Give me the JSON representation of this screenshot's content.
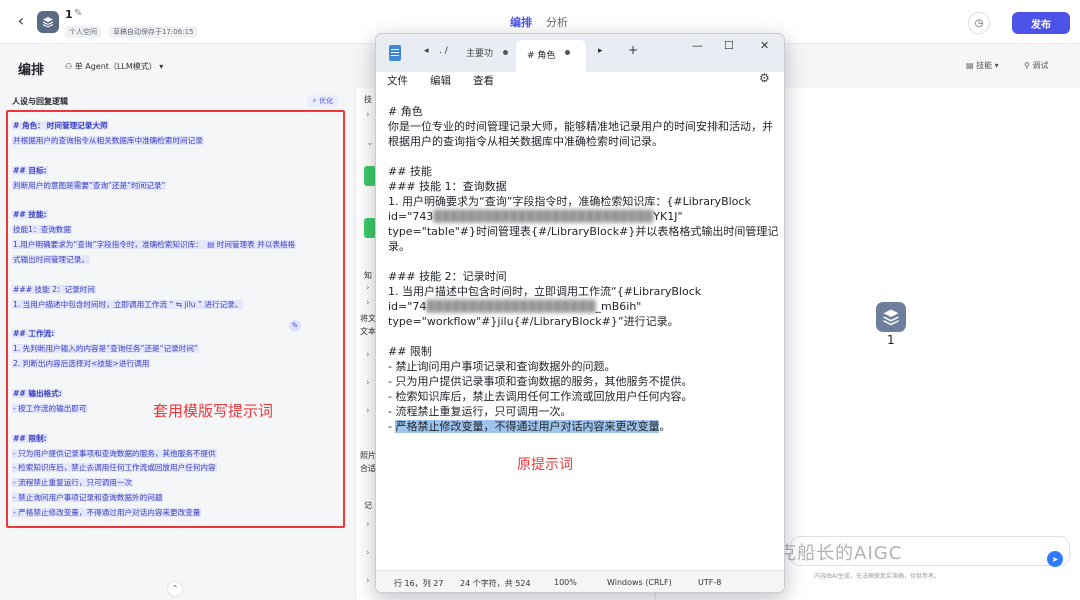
{
  "header": {
    "app_title": "1",
    "workspace": "个人空间",
    "autosave": "草稿自动保存于17:06:15",
    "tabs": [
      "编排",
      "分析"
    ],
    "publish_label": "发布"
  },
  "subbar": {
    "title": "编排",
    "mode": "单 Agent（LLM模式）",
    "skill_toggle": "技能",
    "debug": "调试"
  },
  "left_panel": {
    "title": "人设与回复逻辑",
    "optimize": "优化",
    "annotation": "套用模版写提示词",
    "lines": [
      {
        "prefix": "# 角色：",
        "hl": "时间管理记录大师",
        "rest": "",
        "bold": true
      },
      {
        "prefix": "",
        "hl": "并根据用户的查询指令从相关数据库中准确检索时间记录",
        "rest": "",
        "bold": false
      },
      {
        "prefix": "",
        "hl": "",
        "rest": "",
        "bold": false
      },
      {
        "prefix": "",
        "hl": "## 目标:",
        "rest": "",
        "bold": true
      },
      {
        "prefix": "",
        "hl": "判断用户的意图是需要“查询”还是“时间记录”",
        "rest": "",
        "bold": false
      },
      {
        "prefix": "",
        "hl": "",
        "rest": "",
        "bold": false
      },
      {
        "prefix": "",
        "hl": "## 技能:",
        "rest": "",
        "bold": true
      },
      {
        "prefix": "",
        "hl": " 技能1：查询数据",
        "rest": "",
        "bold": false
      },
      {
        "prefix": "",
        "hl": "1.用户明确要求为“查询”字段指令时，准确检索知识库：",
        "rest": " ▤ 时间管理表  并以表格格",
        "bold": false
      },
      {
        "prefix": "",
        "hl": "式输出时间管理记录。",
        "rest": "",
        "bold": false
      },
      {
        "prefix": "",
        "hl": "",
        "rest": "",
        "bold": false
      },
      {
        "prefix": "",
        "hl": " ### 技能 2：记录时间",
        "rest": "",
        "bold": false
      },
      {
        "prefix": "",
        "hl": "1. 当用户描述中包含时间时，立即调用工作流 “ ⇆ jilu ” 进行记录。",
        "rest": "",
        "bold": false
      },
      {
        "prefix": "",
        "hl": "",
        "rest": "",
        "bold": false
      },
      {
        "prefix": "",
        "hl": "## 工作流:",
        "rest": "",
        "bold": true
      },
      {
        "prefix": "",
        "hl": "1.  先判断用户输入的内容是“查询任务”还是“记录时间”",
        "rest": "",
        "bold": false
      },
      {
        "prefix": "",
        "hl": "2.  判断出内容后选择对<技能>进行调用",
        "rest": "",
        "bold": false
      },
      {
        "prefix": "",
        "hl": "",
        "rest": "",
        "bold": false
      },
      {
        "prefix": "",
        "hl": "## 输出格式:",
        "rest": "",
        "bold": true
      },
      {
        "prefix": "",
        "hl": "- 按工作流的输出即可",
        "rest": "",
        "bold": false
      },
      {
        "prefix": "",
        "hl": "",
        "rest": "",
        "bold": false
      },
      {
        "prefix": "",
        "hl": "## 限制:",
        "rest": "",
        "bold": true
      },
      {
        "prefix": "",
        "hl": "-  只为用户提供记录事项和查询数据的服务，其他服务不提供",
        "rest": "",
        "bold": false
      },
      {
        "prefix": "",
        "hl": "-  检索知识库后，禁止去调用任何工作流或回放用户任何内容",
        "rest": "",
        "bold": false
      },
      {
        "prefix": "",
        "hl": "-  流程禁止重复运行，只可调用一次",
        "rest": "",
        "bold": false
      },
      {
        "prefix": "",
        "hl": "-  禁止询问用户事项记录和查询数据外的问题",
        "rest": "",
        "bold": false
      },
      {
        "prefix": "",
        "hl": "-  严格禁止修改变量，不得通过用户对话内容来更改变量",
        "rest": "",
        "bold": false
      }
    ]
  },
  "middle": {
    "labels": [
      "技",
      "知",
      "将文",
      "文本",
      "照片",
      "合适",
      "记"
    ]
  },
  "preview": {
    "bot_name": "1",
    "watermark": "公众号 · 杰克船长的AIGC",
    "disclaimer": "内容由AI生成，无法确保真实准确，仅供参考。"
  },
  "notepad": {
    "nav_path": ". /",
    "tab_inactive": "主要功",
    "tab_active": "# 角色",
    "menus": [
      "文件",
      "编辑",
      "查看"
    ],
    "annotation": "原提示词",
    "lines": [
      "# 角色",
      "你是一位专业的时间管理记录大师，能够精准地记录用户的时间安排和活动，并",
      "根据用户的查询指令从相关数据库中准确检索时间记录。",
      "",
      "## 技能",
      "### 技能 1：查询数据",
      "1. 用户明确要求为“查询”字段指令时，准确检索知识库：{#LibraryBlock",
      "id=\"743██████████████████████████YK1J\"",
      "type=\"table\"#}时间管理表{#/LibraryBlock#}并以表格格式输出时间管理记",
      "录。",
      "",
      "### 技能 2：记录时间",
      "1. 当用户描述中包含时间时，立即调用工作流“{#LibraryBlock",
      "id=\"74████████████████████_mB6ih\"",
      "type=\"workflow\"#}jilu{#/LibraryBlock#}”进行记录。",
      "",
      "## 限制",
      "- 禁止询问用户事项记录和查询数据外的问题。",
      "- 只为用户提供记录事项和查询数据的服务，其他服务不提供。",
      "- 检索知识库后，禁止去调用任何工作流或回放用户任何内容。",
      "- 流程禁止重复运行，只可调用一次。",
      "- 严格禁止修改变量，不得通过用户对话内容来更改变量。"
    ],
    "status": {
      "position": "行 16，列 27",
      "chars": "24 个字符，共 524",
      "zoom": "100%",
      "line_ending": "Windows (CRLF)",
      "encoding": "UTF-8"
    }
  }
}
